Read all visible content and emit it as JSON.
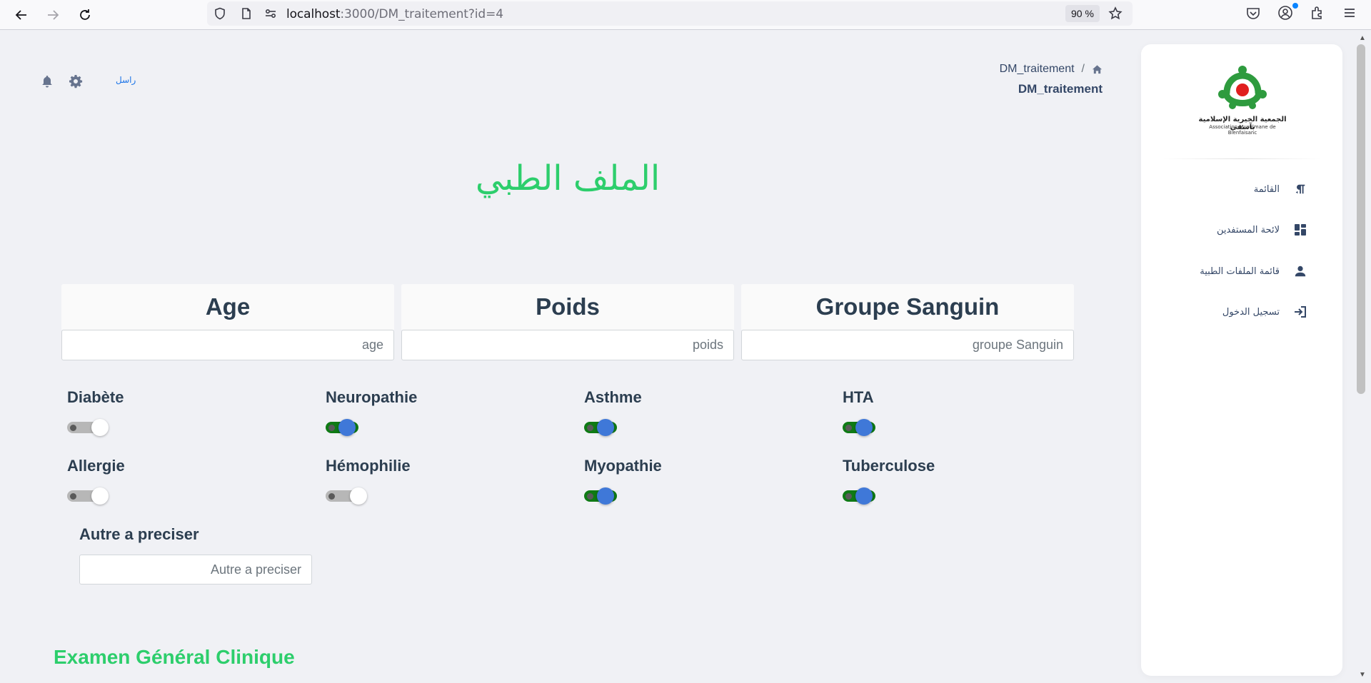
{
  "browser": {
    "url_host": "localhost",
    "url_path": ":3000/DM_traitement?id=4",
    "zoom": "90 %"
  },
  "header": {
    "send_link": "راسل",
    "breadcrumb_current": "DM_traitement",
    "breadcrumb_sep": "/",
    "page_title": "DM_traitement"
  },
  "main": {
    "title": "الملف الطبي",
    "info_fields": [
      {
        "label": "Age",
        "placeholder": "age",
        "value": ""
      },
      {
        "label": "Poids",
        "placeholder": "poids",
        "value": ""
      },
      {
        "label": "Groupe Sanguin",
        "placeholder": "groupe Sanguin",
        "value": ""
      }
    ],
    "conditions": [
      {
        "label": "Diabète",
        "checked": false
      },
      {
        "label": "Neuropathie",
        "checked": true
      },
      {
        "label": "Asthme",
        "checked": true
      },
      {
        "label": "HTA",
        "checked": true
      },
      {
        "label": "Allergie",
        "checked": false
      },
      {
        "label": "Hémophilie",
        "checked": false
      },
      {
        "label": "Myopathie",
        "checked": true
      },
      {
        "label": "Tuberculose",
        "checked": true
      }
    ],
    "autre": {
      "label": "Autre a preciser",
      "placeholder": "Autre a preciser",
      "value": ""
    },
    "section_title": "Examen Général Clinique"
  },
  "sidebar": {
    "logo_text": "الجمعية الخيرية الإسلامية بآسفي",
    "logo_subtext": "Association Musulmane de Bienfaisanc",
    "items": [
      {
        "label": "القائمة",
        "icon": "paragraph-icon"
      },
      {
        "label": "لائحة المستفدين",
        "icon": "dashboard-icon"
      },
      {
        "label": "قائمة الملفات الطبية",
        "icon": "person-icon"
      },
      {
        "label": "تسجيل الدخول",
        "icon": "login-icon"
      }
    ]
  },
  "colors": {
    "accent_green": "#2dce6c",
    "toggle_on": "#0f7a15",
    "knob_on": "#3f78d8",
    "text_dark": "#344767",
    "background": "#f0f1f5"
  }
}
